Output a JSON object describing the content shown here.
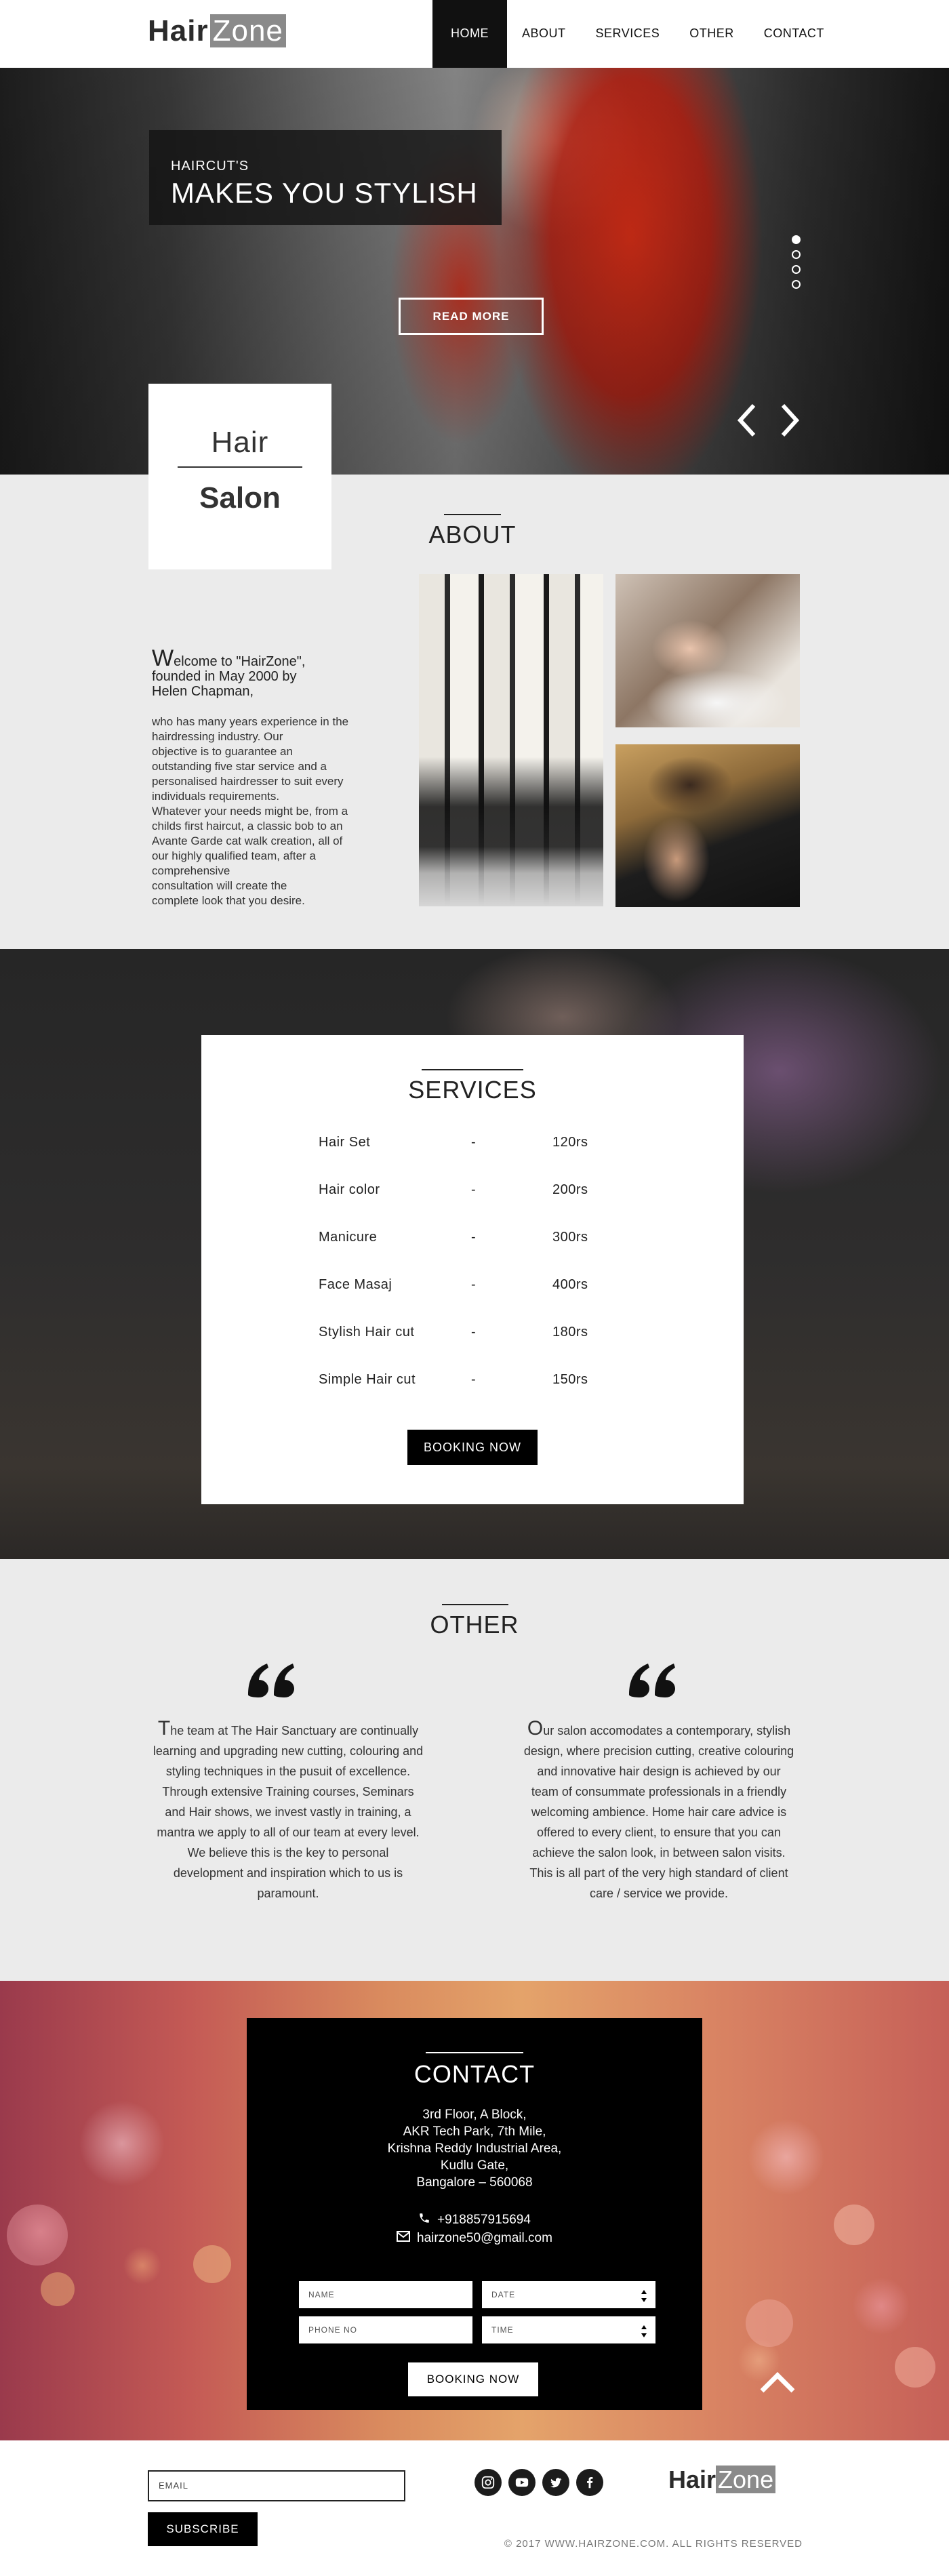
{
  "header": {
    "logo_part1": "Hair",
    "logo_part2": "Zone",
    "nav": [
      {
        "label": "HOME",
        "active": true
      },
      {
        "label": "ABOUT",
        "active": false
      },
      {
        "label": "SERVICES",
        "active": false
      },
      {
        "label": "OTHER",
        "active": false
      },
      {
        "label": "CONTACT",
        "active": false
      }
    ]
  },
  "hero": {
    "kicker": "HAIRCUT'S",
    "title": "MAKES YOU STYLISH",
    "cta_label": "READ MORE",
    "slide_count": 4,
    "active_slide": 1,
    "prev_icon": "chevron-left-icon",
    "next_icon": "chevron-right-icon"
  },
  "salon_box": {
    "line1": "Hair",
    "line2": "Salon"
  },
  "about": {
    "title": "ABOUT",
    "welcome_initial": "W",
    "welcome_rest": "elcome to \"HairZone\",",
    "welcome_line2": "founded in May 2000 by",
    "welcome_line3": "Helen Chapman,",
    "body": "who has many years experience in the\nhairdressing industry. Our\nobjective is to guarantee an\noutstanding five star service and a\npersonalised hairdresser to suit every\nindividuals requirements.\nWhatever your needs might be, from a\nchilds first haircut, a classic bob to an\nAvante Garde cat walk creation, all of\nour highly qualified team, after a\ncomprehensive\nconsultation will create the\ncomplete look that you desire."
  },
  "services": {
    "title": "SERVICES",
    "items": [
      {
        "name": "Hair Set",
        "dash": "-",
        "price": "120rs"
      },
      {
        "name": "Hair color",
        "dash": "-",
        "price": "200rs"
      },
      {
        "name": "Manicure",
        "dash": "-",
        "price": "300rs"
      },
      {
        "name": "Face Masaj",
        "dash": "-",
        "price": "400rs"
      },
      {
        "name": "Stylish Hair cut",
        "dash": "-",
        "price": "180rs"
      },
      {
        "name": "Simple Hair cut",
        "dash": "-",
        "price": "150rs"
      }
    ],
    "cta_label": "BOOKING NOW"
  },
  "other": {
    "title": "OTHER",
    "quote_icon": "quote-icon",
    "quotes": [
      {
        "initial": "T",
        "text": "he team at The Hair Sanctuary are continually learning and upgrading new cutting, colouring and styling techniques in the pusuit of excellence. Through extensive Training courses, Seminars and Hair shows, we invest vastly in training, a mantra we apply to all of our team at every level. We believe this is the key to personal development and inspiration which to us is paramount."
      },
      {
        "initial": "O",
        "text": "ur salon accomodates a contemporary, stylish design, where precision cutting, creative colouring and innovative hair design is achieved by our team of consummate professionals in a friendly welcoming ambience. Home hair care advice is offered to every client, to ensure that you can achieve the salon look, in between salon visits. This is all part of the very high standard of client care / service we provide."
      }
    ]
  },
  "contact": {
    "title": "CONTACT",
    "address": "3rd Floor, A Block,\nAKR Tech Park, 7th Mile,\nKrishna Reddy Industrial Area,\nKudlu Gate,\nBangalore – 560068",
    "phone": "+918857915694",
    "email": "hairzone50@gmail.com",
    "phone_icon": "phone-icon",
    "email_icon": "envelope-icon",
    "form": {
      "name_placeholder": "NAME",
      "date_placeholder": "DATE",
      "phone_placeholder": "PHONE NO",
      "time_placeholder": "TIME"
    },
    "cta_label": "BOOKING NOW",
    "to_top_icon": "chevron-up-icon"
  },
  "footer": {
    "email_placeholder": "EMAIL",
    "subscribe_label": "SUBSCRIBE",
    "social": [
      "instagram-icon",
      "youtube-icon",
      "twitter-icon",
      "facebook-icon"
    ],
    "logo_part1": "Hair",
    "logo_part2": "Zone",
    "copyright": "© 2017 WWW.HAIRZONE.COM. ALL RIGHTS RESERVED"
  }
}
